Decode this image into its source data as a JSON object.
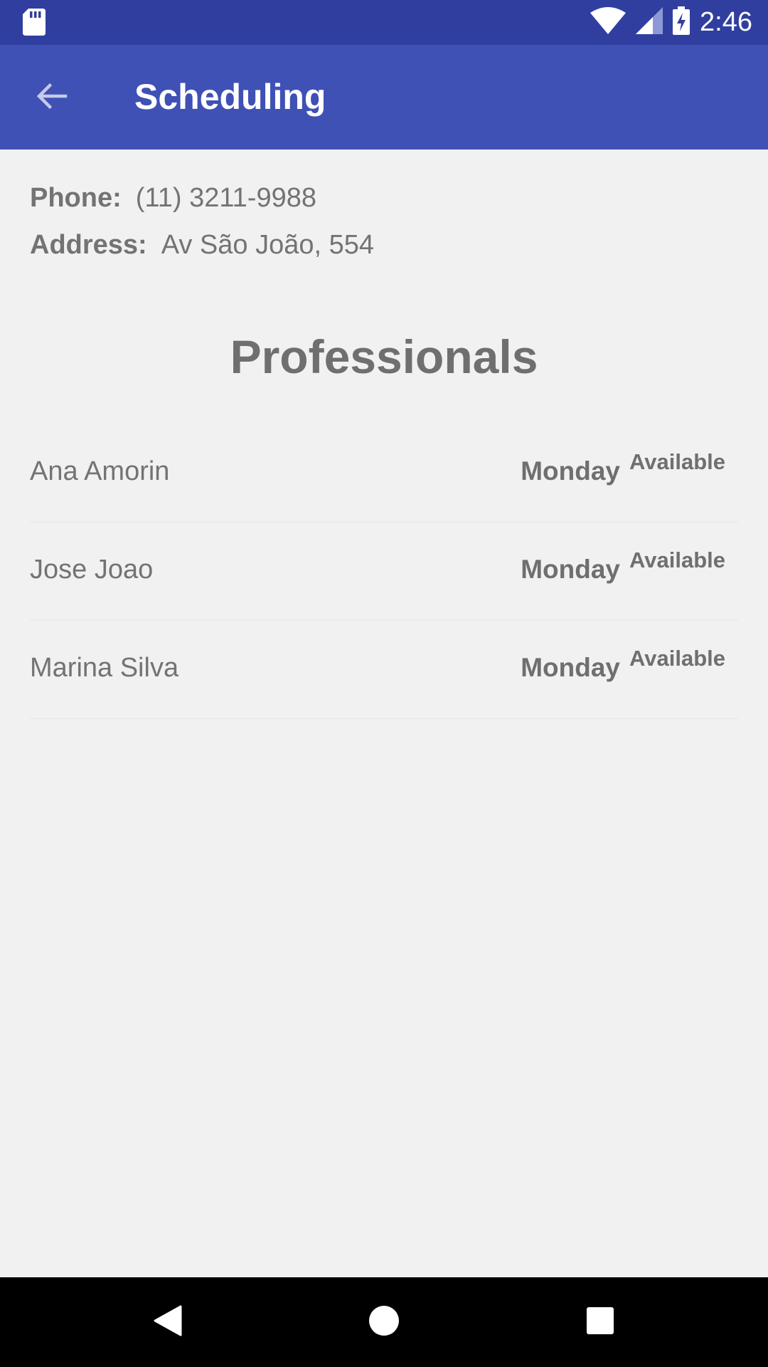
{
  "status_bar": {
    "time": "2:46",
    "icons": [
      "sd-card-icon",
      "wifi-icon",
      "signal-icon",
      "battery-charging-icon"
    ]
  },
  "app_bar": {
    "title": "Scheduling",
    "back_icon": "arrow-back-icon"
  },
  "info": {
    "phone_label": "Phone:",
    "phone_value": "(11) 3211-9988",
    "address_label": "Address:",
    "address_value": "Av São João, 554"
  },
  "professionals": {
    "title": "Professionals",
    "items": [
      {
        "name": "Ana Amorin",
        "day": "Monday",
        "status": "Available"
      },
      {
        "name": "Jose Joao",
        "day": "Monday",
        "status": "Available"
      },
      {
        "name": "Marina Silva",
        "day": "Monday",
        "status": "Available"
      }
    ]
  },
  "nav_bar": {
    "icons": [
      "nav-back-icon",
      "nav-home-icon",
      "nav-recents-icon"
    ]
  },
  "colors": {
    "status_bar": "#303f9f",
    "app_bar": "#3f51b5",
    "background": "#f1f1f1",
    "text": "#737373"
  }
}
